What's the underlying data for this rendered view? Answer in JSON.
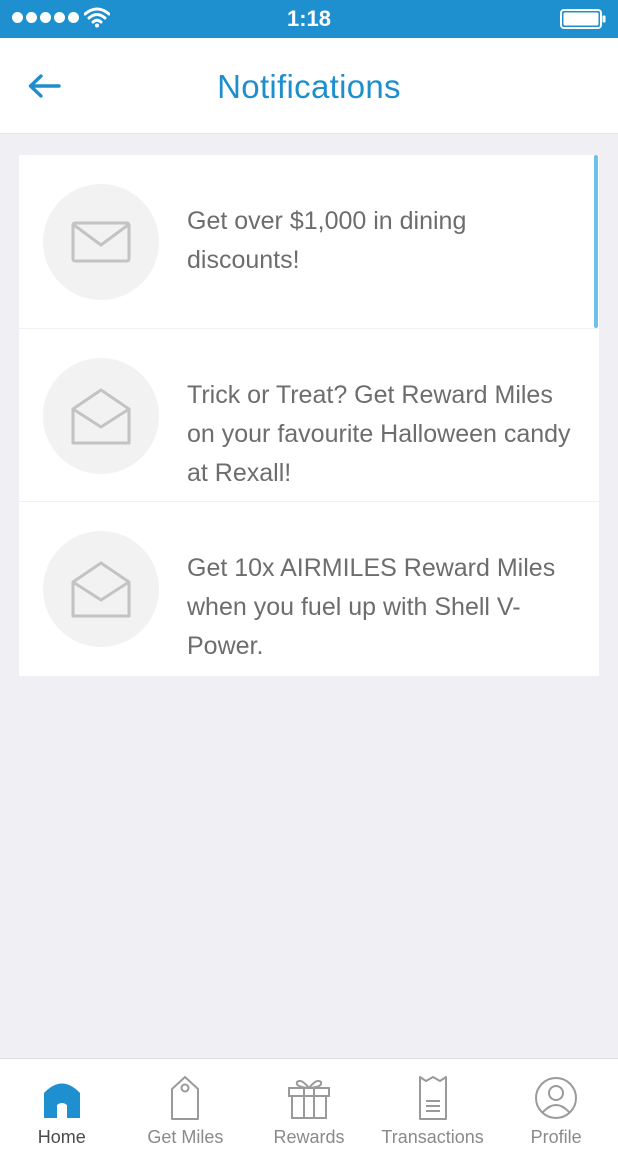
{
  "status_bar": {
    "time": "1:18",
    "signal_icon": "signal-dots-icon",
    "wifi_icon": "wifi-icon",
    "battery_icon": "battery-icon"
  },
  "header": {
    "title": "Notifications",
    "back_icon": "arrow-left-icon"
  },
  "colors": {
    "accent": "#1e8fcf",
    "background": "#efeff4",
    "text": "#6d6d6d"
  },
  "notifications": [
    {
      "text": "Get over $1,000 in dining discounts!",
      "icon": "envelope-closed-icon",
      "read": false
    },
    {
      "text": "Trick or Treat? Get Reward Miles on your favourite Halloween candy at Rexall!",
      "icon": "envelope-open-icon",
      "read": true
    },
    {
      "text": "Get 10x AIRMILES Reward Miles when you fuel up with Shell V-Power.",
      "icon": "envelope-open-icon",
      "read": true
    }
  ],
  "tabs": [
    {
      "label": "Home",
      "icon": "home-icon",
      "active": true
    },
    {
      "label": "Get Miles",
      "icon": "tag-icon",
      "active": false
    },
    {
      "label": "Rewards",
      "icon": "gift-icon",
      "active": false
    },
    {
      "label": "Transactions",
      "icon": "receipt-icon",
      "active": false
    },
    {
      "label": "Profile",
      "icon": "profile-icon",
      "active": false
    }
  ]
}
